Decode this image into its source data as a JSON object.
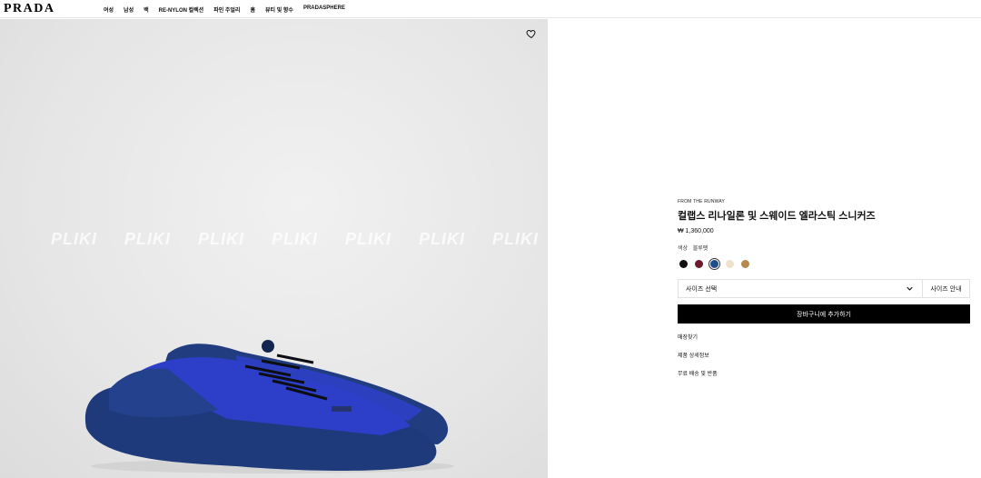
{
  "header": {
    "logo": "PRADA",
    "nav": [
      "여성",
      "남성",
      "백",
      "RE-NYLON 컬렉션",
      "파인 주얼리",
      "홈",
      "뷰티 및 향수",
      "PRADASPHERE"
    ]
  },
  "image": {
    "watermark": [
      "PLIKI",
      "PLIKI",
      "PLIKI",
      "PLIKI",
      "PLIKI",
      "PLIKI",
      "PLIKI"
    ],
    "wishlist_icon": "heart-outline-icon"
  },
  "product": {
    "eyebrow": "FROM THE RUNWAY",
    "title": "컬랩스 리나일론 및 스웨이드 엘라스틱 스니커즈",
    "price": "₩ 1,360,000",
    "color_label": "색상",
    "color_value": "블루펫",
    "swatches": [
      {
        "name": "black",
        "hex": "#111111"
      },
      {
        "name": "burgundy",
        "hex": "#6b1a2b"
      },
      {
        "name": "blue",
        "hex": "#1f4c8c",
        "selected": true
      },
      {
        "name": "cream",
        "hex": "#efe2cc"
      },
      {
        "name": "tan",
        "hex": "#b48a4e"
      }
    ],
    "size_select": "사이즈 선택",
    "size_guide": "사이즈 안내",
    "add_to_cart": "장바구니에 추가하기",
    "links": [
      "매장찾기",
      "제품 상세정보",
      "무료 배송 및 반품"
    ]
  }
}
